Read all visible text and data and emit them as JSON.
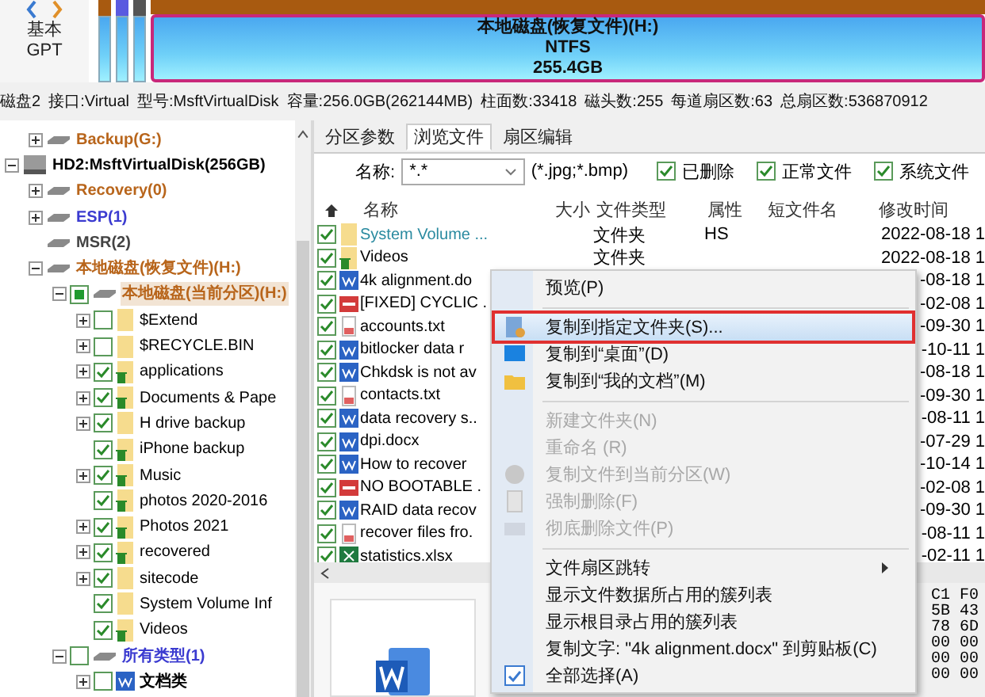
{
  "disk_map": {
    "type_lines": [
      "基本",
      "GPT"
    ],
    "partitions": [
      {
        "kind": "small",
        "color": "#a85a10",
        "selected": false
      },
      {
        "kind": "small",
        "color": "#5a5ae0",
        "selected": false
      },
      {
        "kind": "small",
        "color": "#555555",
        "selected": false
      },
      {
        "kind": "main",
        "color": "#a85a10",
        "selected": true,
        "lines": [
          "本地磁盘(恢复文件)(H:)",
          "NTFS",
          "255.4GB"
        ]
      }
    ]
  },
  "disk_info": [
    "磁盘2",
    "接口:Virtual",
    "型号:MsftVirtualDisk",
    "容量:256.0GB(262144MB)",
    "柱面数:33418",
    "磁头数:255",
    "每道扇区数:63",
    "总扇区数:536870912"
  ],
  "tree": {
    "prev_disk_children": [
      {
        "kind": "partition",
        "label": "Backup(G:)",
        "color": "#b8651b",
        "expanded": false,
        "selected": false
      }
    ],
    "disks": [
      {
        "kind": "disk",
        "label": "HD2:MsftVirtualDisk(256GB)",
        "color": "#000000",
        "expanded": true,
        "selected": false,
        "children": [
          {
            "kind": "partition",
            "label": "Recovery(0)",
            "color": "#b8651b",
            "expanded": false,
            "selected": false
          },
          {
            "kind": "partition",
            "label": "ESP(1)",
            "color": "#3b3bd0",
            "expanded": false,
            "selected": false
          },
          {
            "kind": "partition",
            "label": "MSR(2)",
            "color": "#444444",
            "selected": false
          },
          {
            "kind": "partition",
            "label": "本地磁盘(恢复文件)(H:)",
            "color": "#b8651b",
            "expanded": true,
            "selected": false,
            "children": [
              {
                "kind": "partition",
                "label": "本地磁盘(当前分区)(H:)",
                "color": "#b8651b",
                "expanded": true,
                "checked": true,
                "partial": true,
                "selected": true,
                "children": [
                  {
                    "kind": "folder",
                    "label": "$Extend",
                    "expanded": false,
                    "checked": false,
                    "deleted": false,
                    "selected": false
                  },
                  {
                    "kind": "folder",
                    "label": "$RECYCLE.BIN",
                    "expanded": false,
                    "checked": false,
                    "deleted": false,
                    "selected": false
                  },
                  {
                    "kind": "folder",
                    "label": "applications",
                    "expanded": false,
                    "checked": true,
                    "deleted": true,
                    "selected": false
                  },
                  {
                    "kind": "folder",
                    "label": "Documents & Pape",
                    "expanded": false,
                    "checked": true,
                    "deleted": true,
                    "selected": false
                  },
                  {
                    "kind": "folder",
                    "label": "H drive backup",
                    "expanded": false,
                    "checked": true,
                    "deleted": false,
                    "selected": false
                  },
                  {
                    "kind": "folder",
                    "label": "iPhone backup",
                    "checked": true,
                    "deleted": true,
                    "selected": false
                  },
                  {
                    "kind": "folder",
                    "label": "Music",
                    "expanded": false,
                    "checked": true,
                    "deleted": true,
                    "selected": false
                  },
                  {
                    "kind": "folder",
                    "label": "photos 2020-2016",
                    "checked": true,
                    "deleted": true,
                    "selected": false
                  },
                  {
                    "kind": "folder",
                    "label": "Photos 2021",
                    "expanded": false,
                    "checked": true,
                    "deleted": true,
                    "selected": false
                  },
                  {
                    "kind": "folder",
                    "label": "recovered",
                    "expanded": false,
                    "checked": true,
                    "deleted": true,
                    "selected": false
                  },
                  {
                    "kind": "folder",
                    "label": "sitecode",
                    "expanded": false,
                    "checked": true,
                    "deleted": false,
                    "selected": false
                  },
                  {
                    "kind": "folder",
                    "label": "System Volume Inf",
                    "checked": true,
                    "deleted": false,
                    "selected": false
                  },
                  {
                    "kind": "folder",
                    "label": "Videos",
                    "checked": true,
                    "deleted": true,
                    "selected": false
                  }
                ]
              },
              {
                "kind": "partition",
                "label": "所有类型(1)",
                "color": "#3b3bd0",
                "expanded": true,
                "checked": false,
                "selected": false,
                "children": [
                  {
                    "kind": "filetype",
                    "label": "文档类",
                    "color": "#000000",
                    "expanded": false,
                    "checked": false,
                    "selected": false
                  }
                ]
              }
            ]
          }
        ]
      }
    ]
  },
  "tabs": [
    {
      "label": "分区参数",
      "selected": false
    },
    {
      "label": "浏览文件",
      "selected": true
    },
    {
      "label": "扇区编辑",
      "selected": false
    }
  ],
  "filter": {
    "label": "名称:",
    "value": "*.*",
    "hint": "(*.jpg;*.bmp)",
    "checkboxes": [
      {
        "label": "已删除",
        "checked": true
      },
      {
        "label": "正常文件",
        "checked": true
      },
      {
        "label": "系统文件",
        "checked": true
      }
    ]
  },
  "table": {
    "columns": [
      "名称",
      "大小",
      "文件类型",
      "属性",
      "短文件名",
      "修改时间"
    ],
    "rows": [
      {
        "kind": "folder",
        "deleted": false,
        "checked": true,
        "name": "System Volume ...",
        "color": "#2a8aa0",
        "type": "文件夹",
        "attr": "HS",
        "modified": "2022-08-18 1"
      },
      {
        "kind": "folder",
        "deleted": true,
        "checked": true,
        "name": "Videos",
        "color": "#000000",
        "type": "文件夹",
        "modified": "2022-08-18 1"
      },
      {
        "kind": "document",
        "deleted": false,
        "checked": true,
        "name": "4k alignment.do",
        "color": "#000000",
        "modified": "-08-18 1"
      },
      {
        "kind": "pdf",
        "deleted": false,
        "checked": true,
        "name": "[FIXED] CYCLIC .",
        "color": "#000000",
        "modified": "-02-08 1"
      },
      {
        "kind": "text",
        "deleted": false,
        "checked": true,
        "name": "accounts.txt",
        "color": "#000000",
        "modified": "-09-30 1"
      },
      {
        "kind": "document",
        "deleted": false,
        "checked": true,
        "name": "bitlocker data r",
        "color": "#000000",
        "modified": "-10-11 1"
      },
      {
        "kind": "document",
        "deleted": false,
        "checked": true,
        "name": "Chkdsk is not av",
        "color": "#000000",
        "modified": "-08-18 1"
      },
      {
        "kind": "text",
        "deleted": false,
        "checked": true,
        "name": "contacts.txt",
        "color": "#000000",
        "modified": "-09-30 1"
      },
      {
        "kind": "document",
        "deleted": false,
        "checked": true,
        "name": "data recovery s..",
        "color": "#000000",
        "modified": "-08-11 1"
      },
      {
        "kind": "document",
        "deleted": false,
        "checked": true,
        "name": "dpi.docx",
        "color": "#000000",
        "modified": "-07-29 1"
      },
      {
        "kind": "document",
        "deleted": false,
        "checked": true,
        "name": "How to recover",
        "color": "#000000",
        "modified": "-10-14 1"
      },
      {
        "kind": "pdf",
        "deleted": false,
        "checked": true,
        "name": "NO BOOTABLE .",
        "color": "#000000",
        "modified": "-02-08 1"
      },
      {
        "kind": "document",
        "deleted": false,
        "checked": true,
        "name": "RAID data recov",
        "color": "#000000",
        "modified": "-09-30 1"
      },
      {
        "kind": "text",
        "deleted": false,
        "checked": true,
        "name": "recover files fro.",
        "color": "#000000",
        "modified": "-08-11 1"
      },
      {
        "kind": "sheet",
        "deleted": false,
        "checked": true,
        "name": "statistics.xlsx",
        "color": "#000000",
        "modified": "-02-11 1"
      }
    ]
  },
  "hex_lines": [
    "C1 F0",
    "5B 43",
    "78 6D",
    "00 00",
    "00 00",
    "00 00"
  ],
  "context_menu": [
    {
      "kind": "item",
      "label": "预览(P)",
      "disabled": false,
      "selected": false
    },
    {
      "kind": "separator"
    },
    {
      "kind": "item",
      "label": "复制到指定文件夹(S)...",
      "disabled": false,
      "selected": true
    },
    {
      "kind": "item",
      "label": "复制到“桌面”(D)",
      "disabled": false,
      "selected": false
    },
    {
      "kind": "item",
      "label": "复制到“我的文档”(M)",
      "disabled": false,
      "selected": false
    },
    {
      "kind": "separator"
    },
    {
      "kind": "item",
      "label": "新建文件夹(N)",
      "disabled": true,
      "selected": false
    },
    {
      "kind": "item",
      "label": "重命名 (R)",
      "disabled": true,
      "selected": false
    },
    {
      "kind": "item",
      "label": "复制文件到当前分区(W)",
      "disabled": true,
      "selected": false
    },
    {
      "kind": "item",
      "label": "强制删除(F)",
      "disabled": true,
      "selected": false
    },
    {
      "kind": "item",
      "label": "彻底删除文件(P)",
      "disabled": true,
      "selected": false
    },
    {
      "kind": "separator"
    },
    {
      "kind": "submenu",
      "label": "文件扇区跳转",
      "disabled": false,
      "selected": false
    },
    {
      "kind": "item",
      "label": "显示文件数据所占用的簇列表",
      "disabled": false,
      "selected": false
    },
    {
      "kind": "item",
      "label": "显示根目录占用的簇列表",
      "disabled": false,
      "selected": false
    },
    {
      "kind": "item",
      "label": "复制文字: \"4k alignment.docx\" 到剪贴板(C)",
      "disabled": false,
      "selected": false
    },
    {
      "kind": "item",
      "label": "全部选择(A)",
      "disabled": false,
      "selected": false
    }
  ]
}
